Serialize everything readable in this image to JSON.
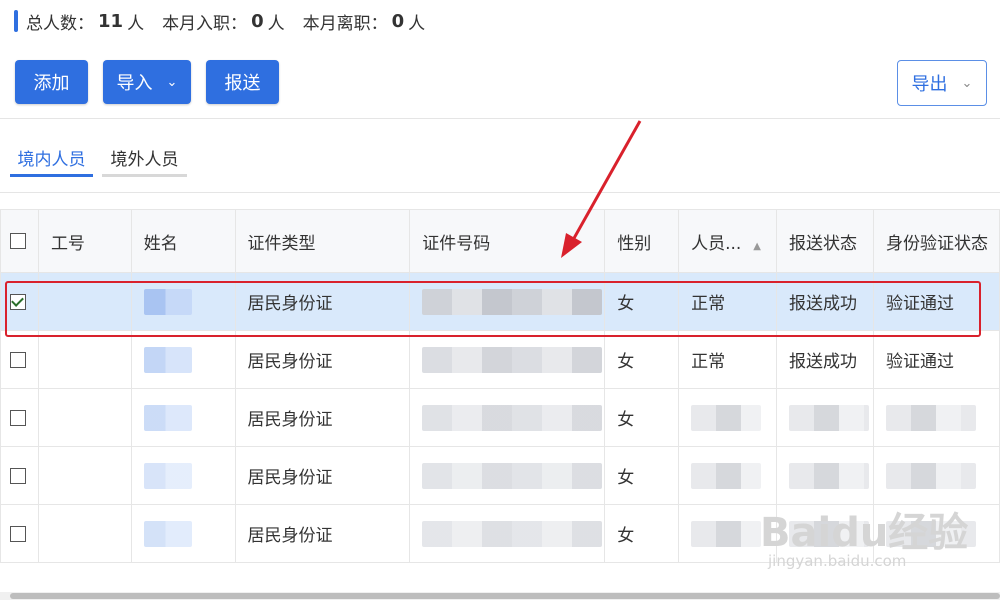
{
  "summary": {
    "total_label": "总人数：",
    "total_value": "11",
    "total_unit": "人",
    "joined_label": "本月入职：",
    "joined_value": "0",
    "joined_unit": "人",
    "left_label": "本月离职：",
    "left_value": "0",
    "left_unit": "人"
  },
  "toolbar": {
    "add_label": "添加",
    "import_label": "导入",
    "submit_label": "报送",
    "export_label": "导出"
  },
  "tabs": [
    {
      "label": "境内人员",
      "active": true
    },
    {
      "label": "境外人员",
      "active": false
    }
  ],
  "table": {
    "columns": [
      "工号",
      "姓名",
      "证件类型",
      "证件号码",
      "性别",
      "人员...",
      "报送状态",
      "身份验证状态"
    ],
    "rows": [
      {
        "checked": true,
        "id_type": "居民身份证",
        "gender": "女",
        "status": "正常",
        "submit_status": "报送成功",
        "verify_status": "验证通过"
      },
      {
        "checked": false,
        "id_type": "居民身份证",
        "gender": "女",
        "status": "正常",
        "submit_status": "报送成功",
        "verify_status": "验证通过"
      },
      {
        "checked": false,
        "id_type": "居民身份证",
        "gender": "女",
        "status": "",
        "submit_status": "",
        "verify_status": ""
      },
      {
        "checked": false,
        "id_type": "居民身份证",
        "gender": "女",
        "status": "",
        "submit_status": "",
        "verify_status": ""
      },
      {
        "checked": false,
        "id_type": "居民身份证",
        "gender": "女",
        "status": "",
        "submit_status": "",
        "verify_status": ""
      }
    ]
  },
  "watermark": {
    "brand": "Baidu经验",
    "url": "jingyan.baidu.com"
  },
  "colors": {
    "accent": "#2f6fe0",
    "highlight": "#d9212c",
    "selected_row": "#d9e9fb"
  }
}
